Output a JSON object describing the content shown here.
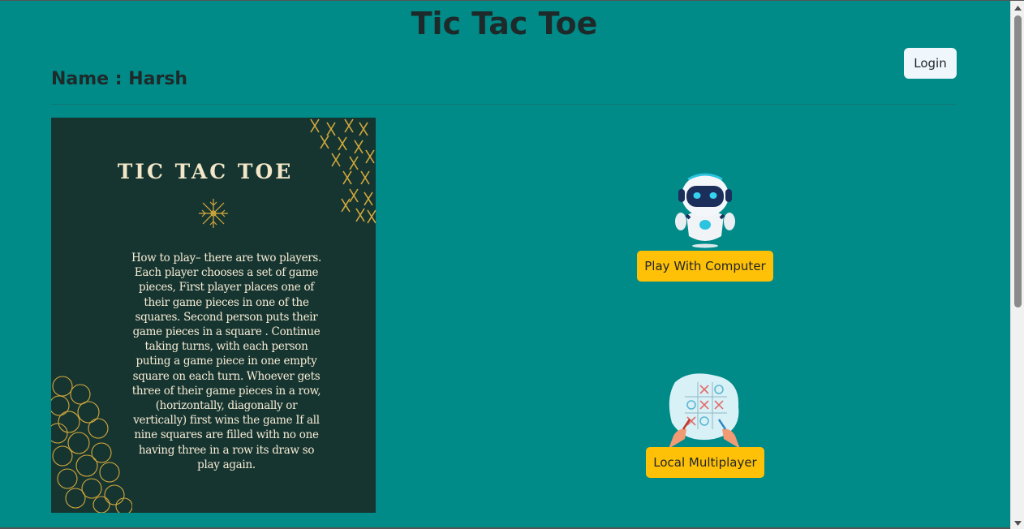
{
  "header": {
    "title": "Tic Tac Toe",
    "player_name": "Name : Harsh",
    "login_label": "Login"
  },
  "poster": {
    "title": "TIC TAC TOE",
    "instructions": "How to play– there are two players. Each player chooses a set of game pieces, First player places one of their game pieces in one of the squares. Second person puts their game pieces in a square . Continue taking turns, with each person puting a game piece in one empty square on each turn. Whoever gets three of their game pieces in a row, (horizontally, diagonally or vertically) first wins the game If all nine squares are filled with no one having three in a row its draw so play again."
  },
  "modes": {
    "computer": {
      "icon": "robot-icon",
      "label": "Play With Computer"
    },
    "multiplayer": {
      "icon": "tic-tac-toe-board-icon",
      "label": "Local Multiplayer"
    }
  },
  "colors": {
    "background": "#008a88",
    "poster": "#173530",
    "accent_button": "#ffc107",
    "gold": "#d4a93c"
  }
}
